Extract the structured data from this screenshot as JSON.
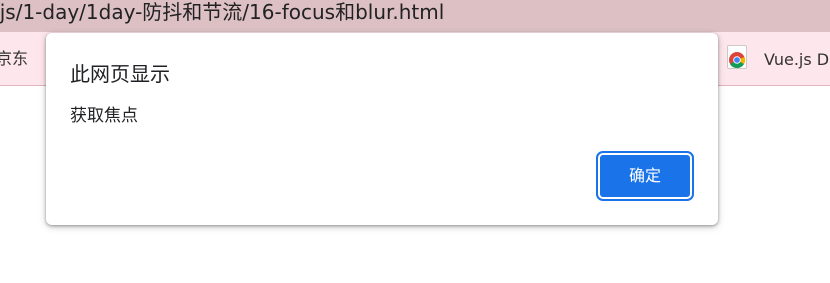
{
  "address_bar": {
    "url_text": "/js/1-day/1day-防抖和节流/16-focus和blur.html"
  },
  "bookmarks": {
    "left_item": "京东",
    "right_item": "Vue.js D",
    "right_icon": "chrome-icon"
  },
  "dialog": {
    "title": "此网页显示",
    "message": "获取焦点",
    "ok_label": "确定",
    "ok_color": "#1a73e8"
  }
}
